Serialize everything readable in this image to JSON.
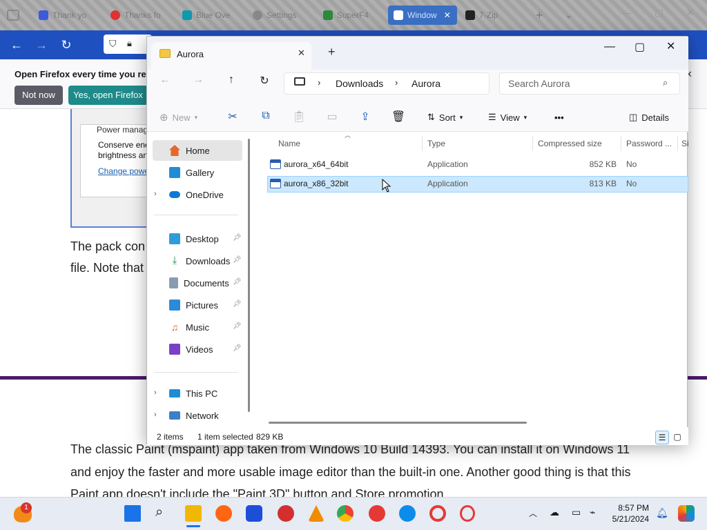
{
  "browser": {
    "tabs": [
      {
        "label": "Thank yo",
        "color": "#3b5bdb"
      },
      {
        "label": "Thanks fo",
        "color": "#e03131"
      },
      {
        "label": "Blue Ove",
        "color": "#1098ad"
      },
      {
        "label": "Settings",
        "color": "#777777"
      },
      {
        "label": "SuperF4",
        "color": "#2b8a3e"
      },
      {
        "label": "Window",
        "color": "#c92a2a"
      },
      {
        "label": "7-Zip",
        "color": "#222222"
      }
    ],
    "notification": {
      "text": "Open Firefox every time you resta",
      "not_now": "Not now",
      "yes_open": "Yes, open Firefox"
    },
    "page": {
      "power_heading": "Power manag",
      "power_line1": "Conserve ene",
      "power_line2": "brightness an",
      "power_link": "Change powe",
      "para1_line1": "The pack con",
      "para1_line2": "file. Note that",
      "para2_line1": "The classic Paint (mspaint) app taken from Windows 10 Build 14393. You can install it on Windows 11",
      "para2_line2": "and enjoy the faster and more usable image editor than the built-in one. Another good thing is that this",
      "para2_line3": "Paint app doesn't include the \"Paint 3D\" button and Store promotion."
    }
  },
  "explorer": {
    "tab_title": "Aurora",
    "breadcrumb": [
      "Downloads",
      "Aurora"
    ],
    "search_placeholder": "Search Aurora",
    "commands": {
      "new": "New",
      "sort": "Sort",
      "view": "View",
      "more": "•••",
      "details": "Details"
    },
    "sidebar": {
      "home": "Home",
      "gallery": "Gallery",
      "onedrive": "OneDrive",
      "desktop": "Desktop",
      "downloads": "Downloads",
      "documents": "Documents",
      "pictures": "Pictures",
      "music": "Music",
      "videos": "Videos",
      "thispc": "This PC",
      "network": "Network"
    },
    "columns": {
      "name": "Name",
      "type": "Type",
      "compressed_size": "Compressed size",
      "password": "Password ...",
      "size": "Si"
    },
    "files": [
      {
        "name": "aurora_x64_64bit",
        "type": "Application",
        "compressed_size": "852 KB",
        "password": "No"
      },
      {
        "name": "aurora_x86_32bit",
        "type": "Application",
        "compressed_size": "813 KB",
        "password": "No"
      }
    ],
    "status": {
      "items": "2 items",
      "selected": "1 item selected",
      "size": "829 KB"
    }
  },
  "taskbar": {
    "badge": "1",
    "time": "8:57 PM",
    "date": "5/21/2024",
    "colors": {
      "start": "#1a73e8",
      "explorer": "#f2b705",
      "firefox": "#ff6611",
      "malwarebytes": "#1d4ed8",
      "ccleaner": "#d32f2f",
      "vlc": "#f08c00",
      "chrome": "#34a853",
      "opera": "#e53935",
      "edge": "#0c8ce9"
    }
  }
}
